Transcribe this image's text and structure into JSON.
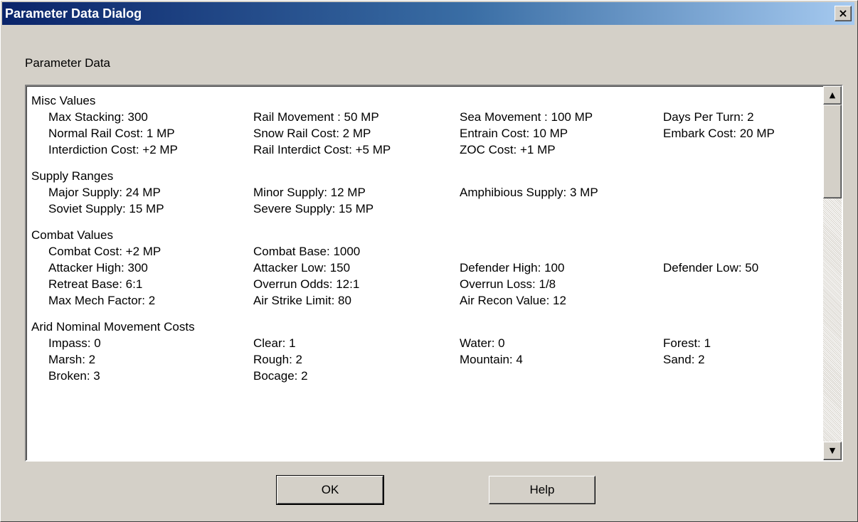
{
  "window": {
    "title": "Parameter Data Dialog",
    "close_label": "×"
  },
  "group_label": "Parameter Data",
  "sections": [
    {
      "title": "Misc Values",
      "rows": [
        [
          "Max Stacking: 300",
          "Rail Movement : 50 MP",
          "Sea Movement : 100 MP",
          "Days Per Turn: 2"
        ],
        [
          "Normal Rail Cost: 1 MP",
          "Snow Rail Cost: 2 MP",
          "Entrain Cost: 10 MP",
          "Embark Cost: 20 MP"
        ],
        [
          "Interdiction Cost: +2 MP",
          "Rail Interdict Cost: +5 MP",
          "ZOC Cost: +1 MP",
          ""
        ]
      ]
    },
    {
      "title": "Supply Ranges",
      "rows": [
        [
          "Major Supply: 24 MP",
          "Minor Supply: 12 MP",
          "Amphibious Supply: 3 MP",
          ""
        ],
        [
          "Soviet Supply: 15 MP",
          "Severe Supply: 15 MP",
          "",
          ""
        ]
      ]
    },
    {
      "title": "Combat Values",
      "rows": [
        [
          "Combat Cost: +2 MP",
          "Combat Base: 1000",
          "",
          ""
        ],
        [
          "Attacker High: 300",
          "Attacker Low: 150",
          "Defender High: 100",
          "Defender Low: 50"
        ],
        [
          "Retreat Base: 6:1",
          "Overrun Odds: 12:1",
          "Overrun Loss: 1/8",
          ""
        ],
        [
          "Max Mech Factor: 2",
          "Air Strike Limit: 80",
          "Air Recon Value: 12",
          ""
        ]
      ]
    },
    {
      "title": "Arid Nominal Movement Costs",
      "rows": [
        [
          "Impass: 0",
          "Clear: 1",
          "Water: 0",
          "Forest: 1"
        ],
        [
          "Marsh: 2",
          "Rough: 2",
          "Mountain: 4",
          "Sand: 2"
        ],
        [
          "Broken: 3",
          "Bocage: 2",
          "",
          ""
        ]
      ]
    }
  ],
  "buttons": {
    "ok": "OK",
    "help": "Help"
  },
  "scrollbar": {
    "up_icon": "▲",
    "down_icon": "▼"
  }
}
